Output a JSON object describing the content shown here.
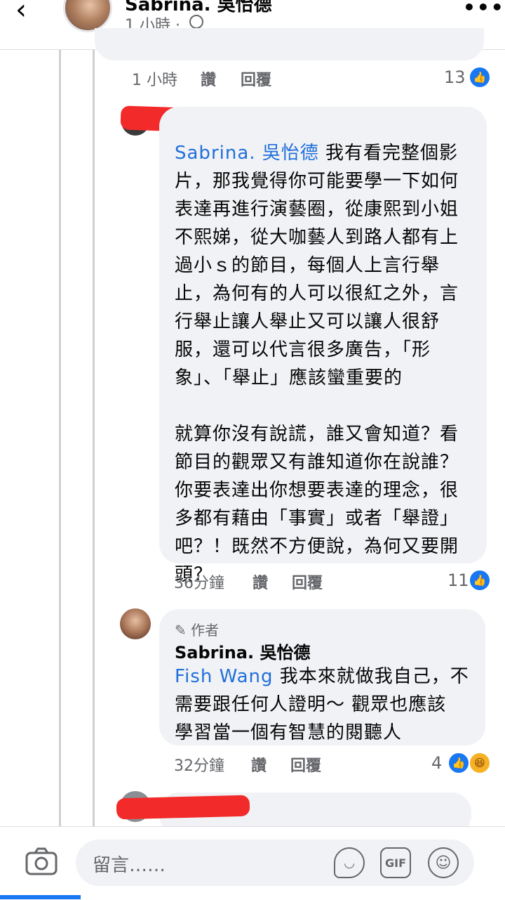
{
  "header": {
    "back_icon": "back-arrow-icon",
    "name": "Sabrina. 吳怡德",
    "time": "1 小時 ·",
    "more_icon": "more-icon"
  },
  "prev_comment": {
    "time": "1 小時",
    "like_label": "讚",
    "reply_label": "回覆",
    "reaction_count": "13"
  },
  "comment1": {
    "mention": "Sabrina. 吳怡德",
    "lines": [
      " 我有看完整個影",
      "片，那我覺得你可能要學一下如何",
      "表達再進行演藝圈，從康熙到小姐",
      "不熙娣，從大咖藝人到路人都有上",
      "過小ｓ的節目，每個人上言行舉",
      "止，為何有的人可以很紅之外，言",
      "行舉止讓人舉止又可以讓人很舒",
      "服，還可以代言很多廣告，「形",
      "象」、「舉止」應該蠻重要的",
      "",
      "就算你沒有說謊，誰又會知道？看",
      "節目的觀眾又有誰知道你在說誰？",
      "你要表達出你想要表達的理念，很",
      "多都有藉由「事實」或者「舉證」",
      "吧？！既然不方便說，為何又要開",
      "頭？"
    ],
    "time": "36分鐘",
    "like_label": "讚",
    "reply_label": "回覆",
    "reaction_count": "11"
  },
  "comment2": {
    "author_badge": "作者",
    "author_name": "Sabrina. 吳怡德",
    "mention": "Fish Wang",
    "lines": [
      " 我本來就做我自己，不",
      "需要跟任何人證明～ 觀眾也應該",
      "學習當一個有智慧的閱聽人"
    ],
    "time": "32分鐘",
    "like_label": "讚",
    "reply_label": "回覆",
    "reaction_count": "4"
  },
  "composer": {
    "placeholder": "留言……",
    "gif_label": "GIF",
    "camera_icon": "camera-icon",
    "sticker_icon": "sticker-icon",
    "emoji_icon": "emoji-icon"
  },
  "colors": {
    "accent": "#1877f2",
    "mention": "#216fdb",
    "bubble": "#f0f2f5",
    "redaction": "#f22a2a"
  }
}
